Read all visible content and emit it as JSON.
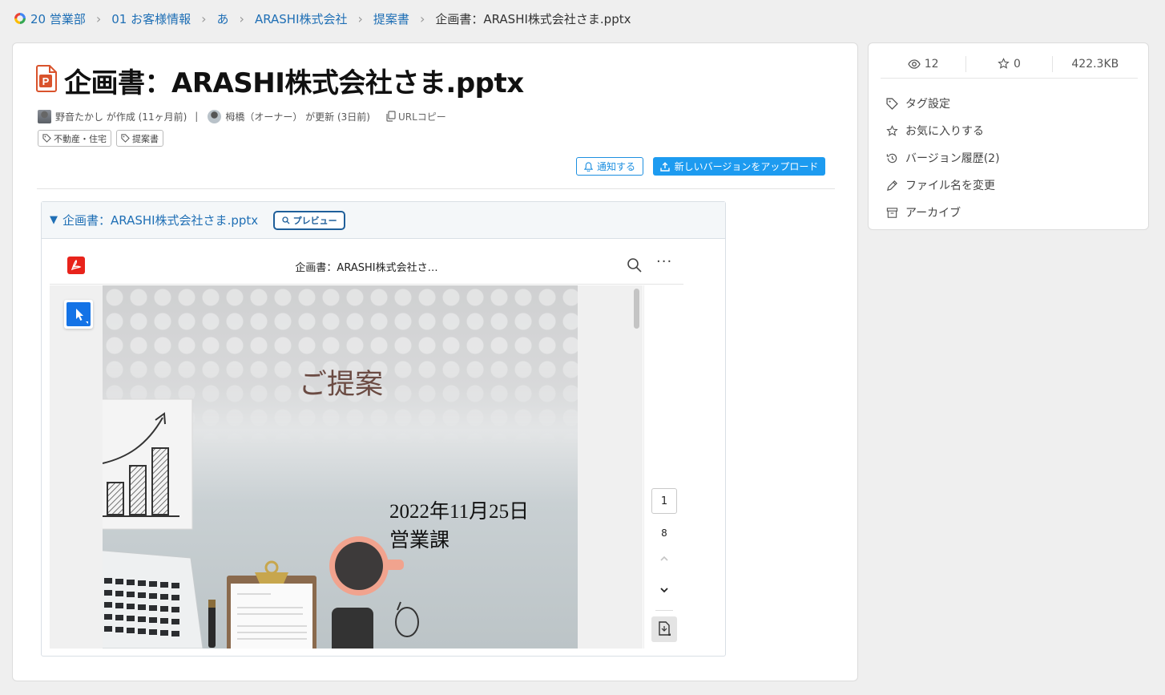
{
  "breadcrumb": {
    "items": [
      "20 営業部",
      "01 お客様情報",
      "あ",
      "ARASHI株式会社",
      "提案書"
    ],
    "current": "企画書：ARASHI株式会社さま.pptx"
  },
  "file": {
    "title": "企画書：ARASHI株式会社さま.pptx",
    "icon": "powerpoint-file-icon"
  },
  "meta": {
    "creator_text": "野音たかし が作成 (11ヶ月前)",
    "separator": "|",
    "updater_text": "栂橋（オーナー） が更新 (3日前)",
    "copy_url": "URLコピー"
  },
  "tags": [
    "不動産・住宅",
    "提案書"
  ],
  "actions": {
    "notify": "通知する",
    "upload": "新しいバージョンをアップロード"
  },
  "preview": {
    "header_name": "企画書：ARASHI株式会社さま.pptx",
    "preview_button": "プレビュー",
    "viewer_title": "企画書：ARASHI株式会社さ…",
    "more": "···",
    "slide": {
      "title": "ご提案",
      "date": "2022年11月25日",
      "dept": "営業課"
    },
    "page_current": "1",
    "page_total": "8"
  },
  "stats": {
    "views": "12",
    "stars": "0",
    "size": "422.3KB"
  },
  "side_menu": {
    "items": [
      "タグ設定",
      "お気に入りする",
      "バージョン履歴(2)",
      "ファイル名を変更",
      "アーカイブ"
    ]
  },
  "colors": {
    "link": "#1f6fb5",
    "primary_button": "#1d9bf0",
    "pdf_red": "#e8231b",
    "select_tool": "#1473e6",
    "slide_title": "#6b4b43"
  }
}
